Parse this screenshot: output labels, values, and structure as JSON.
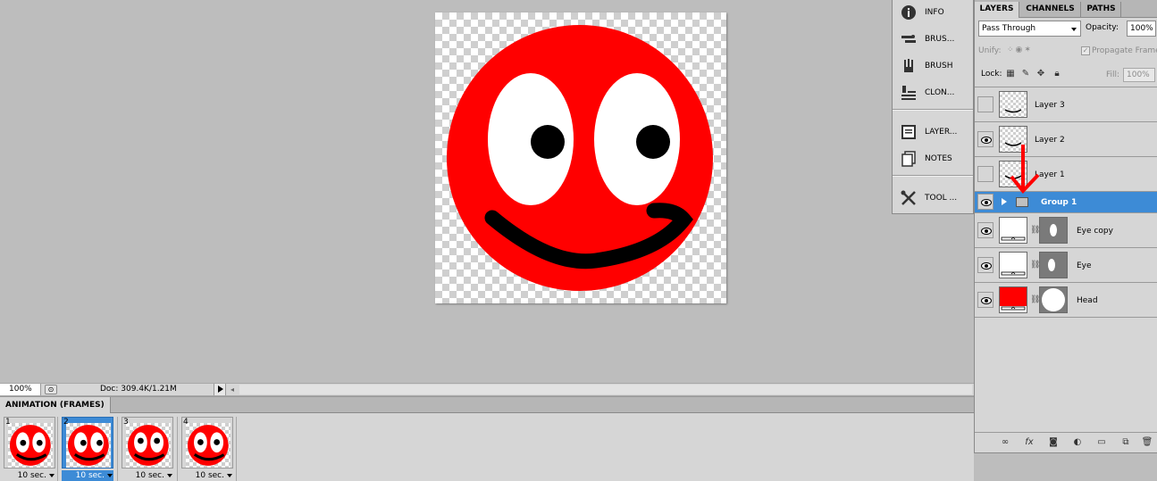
{
  "document": {
    "zoom": "100%",
    "doc_info": "Doc: 309.4K/1.21M"
  },
  "animation_panel": {
    "tab_label": "ANIMATION (FRAMES)",
    "frames": [
      {
        "number": "1",
        "delay": "10 sec.",
        "selected": false
      },
      {
        "number": "2",
        "delay": "10 sec.",
        "selected": true
      },
      {
        "number": "3",
        "delay": "10 sec.",
        "selected": false
      },
      {
        "number": "4",
        "delay": "10 sec.",
        "selected": false
      }
    ]
  },
  "icon_strip": {
    "items": [
      {
        "label": "INFO",
        "icon": "info-icon"
      },
      {
        "label": "BRUS...",
        "icon": "brush-presets-icon"
      },
      {
        "label": "BRUSH",
        "icon": "brush-icon"
      },
      {
        "label": "CLON...",
        "icon": "clone-source-icon"
      },
      {
        "label": "LAYER...",
        "icon": "layer-comps-icon"
      },
      {
        "label": "NOTES",
        "icon": "notes-icon"
      },
      {
        "label": "TOOL ...",
        "icon": "tool-presets-icon"
      }
    ]
  },
  "layers_panel": {
    "tabs": [
      "LAYERS",
      "CHANNELS",
      "PATHS"
    ],
    "active_tab": "LAYERS",
    "blend_mode": "Pass Through",
    "opacity_label": "Opacity:",
    "opacity": "100%",
    "unify_label": "Unify:",
    "propagate_label": "Propagate Frame",
    "lock_label": "Lock:",
    "fill_label": "Fill:",
    "fill": "100%",
    "layers": [
      {
        "name": "Layer 3",
        "visible": false
      },
      {
        "name": "Layer 2",
        "visible": true
      },
      {
        "name": "Layer 1",
        "visible": false
      },
      {
        "name": "Group 1",
        "visible": true,
        "group": true,
        "selected": true
      },
      {
        "name": "Eye copy",
        "visible": true
      },
      {
        "name": "Eye",
        "visible": true
      },
      {
        "name": "Head",
        "visible": true
      }
    ]
  },
  "colors": {
    "face_red": "#ff0000",
    "selection_blue": "#3d8bd6",
    "arrow_red": "#ff0000"
  }
}
